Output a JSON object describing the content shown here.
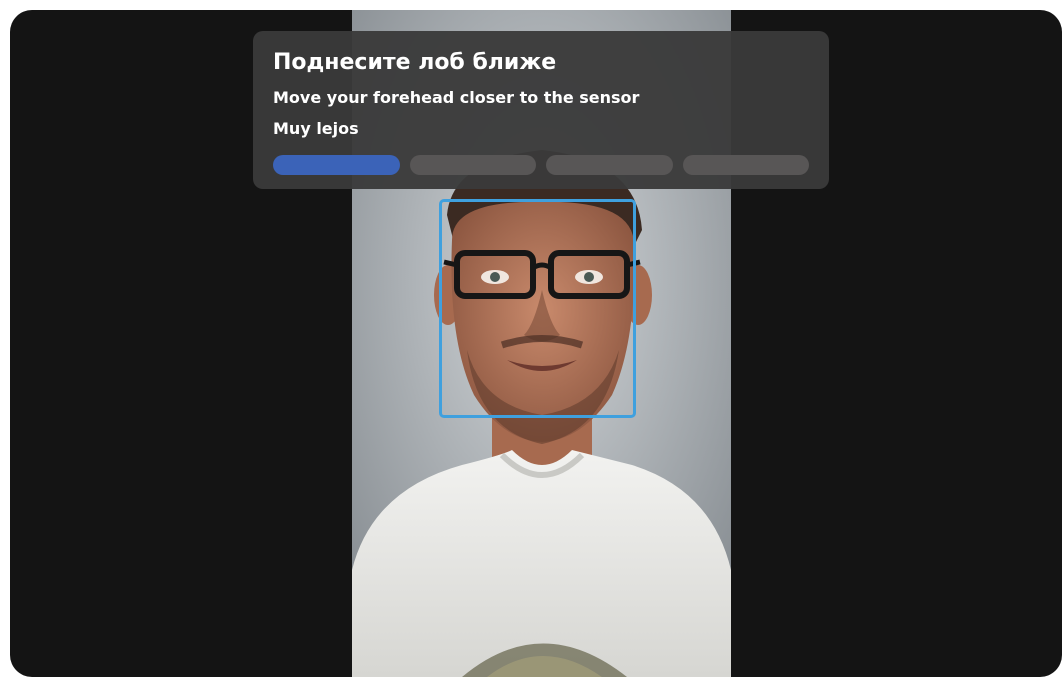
{
  "prompt": {
    "title_ru": "Поднесите лоб ближе",
    "subtitle_en": "Move your forehead closer to the sensor",
    "status_es": "Muy lejos"
  },
  "progress": {
    "total_steps": 4,
    "completed_steps": 1,
    "active_color": "#3b63b8",
    "inactive_color": "#585656"
  },
  "face_detection": {
    "box_color": "#3fa0de"
  },
  "colors": {
    "window_background": "#141414",
    "panel_background": "#3a3a3a"
  }
}
